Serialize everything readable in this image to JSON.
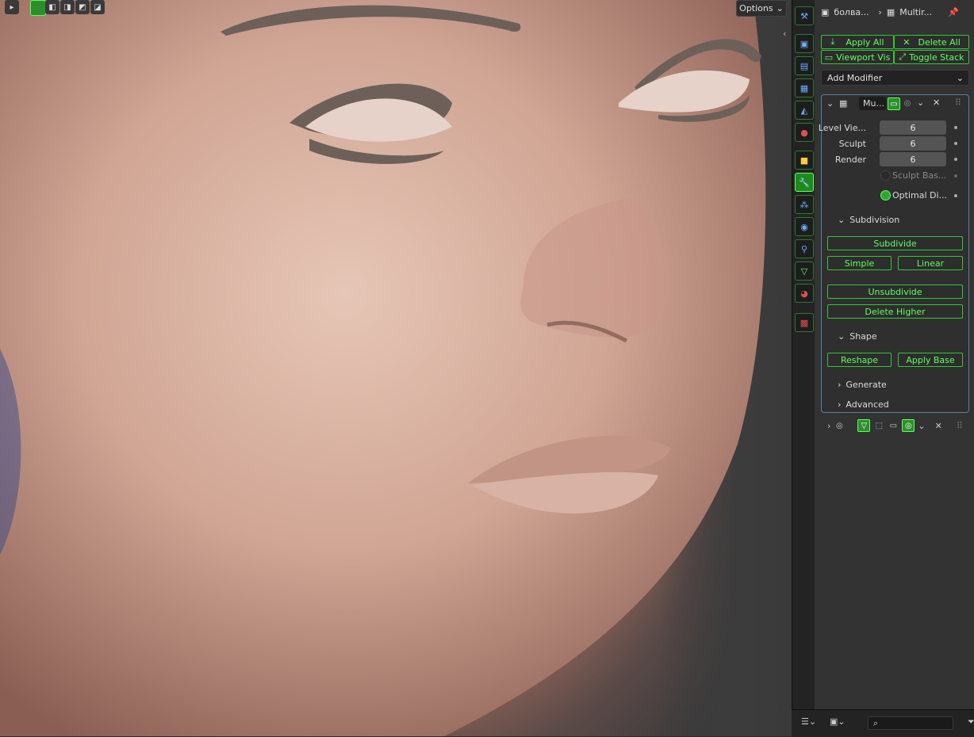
{
  "viewport": {
    "options_label": "Options"
  },
  "panel": {
    "breadcrumb_object": "болва...",
    "breadcrumb_modifier": "Multir...",
    "buttons": {
      "apply_all": "Apply All",
      "delete_all": "Delete All",
      "viewport_vis": "Viewport Vis",
      "toggle_stack": "Toggle Stack"
    },
    "add_modifier": "Add Modifier",
    "modifier": {
      "name": "Mu...",
      "fields": [
        {
          "label": "Level Vie...",
          "value": "6"
        },
        {
          "label": "Sculpt",
          "value": "6"
        },
        {
          "label": "Render",
          "value": "6"
        }
      ],
      "sculpt_base": "Sculpt Bas...",
      "optimal_display": "Optimal Di...",
      "subdivision_title": "Subdivision",
      "subdivide": "Subdivide",
      "simple": "Simple",
      "linear": "Linear",
      "unsubdivide": "Unsubdivide",
      "delete_higher": "Delete Higher",
      "shape_title": "Shape",
      "reshape": "Reshape",
      "apply_base": "Apply Base",
      "generate_title": "Generate",
      "advanced_title": "Advanced"
    }
  },
  "colors": {
    "accent_green": "#5fff5f",
    "panel_bg": "#333333"
  }
}
